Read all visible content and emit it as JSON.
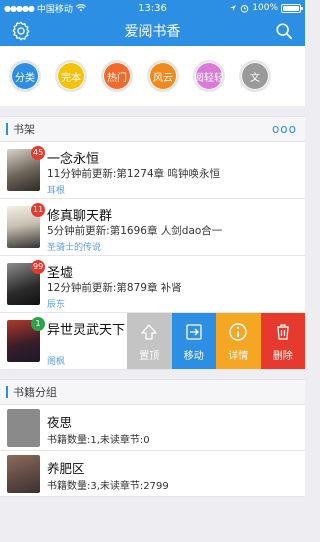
{
  "status_bar": {
    "carrier": "中国移动",
    "time": "13:36",
    "battery": "100%",
    "battery_level": 1.0
  },
  "nav": {
    "title": "爱阅书香",
    "settings_icon": "gear-icon",
    "search_icon": "search-icon"
  },
  "categories": [
    {
      "label": "分类",
      "color": "#2d8fe3"
    },
    {
      "label": "完本",
      "color": "#f4c20d"
    },
    {
      "label": "热门",
      "color": "#f26a2b"
    },
    {
      "label": "风云",
      "color": "#f08a1c"
    },
    {
      "label": "阅轻轻",
      "color": "#d97ad8"
    },
    {
      "label": "文",
      "color": "#9a9a9a"
    }
  ],
  "shelf": {
    "title": "书架",
    "more": "ooo",
    "books": [
      {
        "title": "一念永恒",
        "update": "11分钟前更新:第1274章 鸣钟唤永恒",
        "author": "耳根",
        "badge": "45"
      },
      {
        "title": "修真聊天群",
        "update": "5分钟前更新:第1696章 人剑dao合一",
        "author": "圣骑士的传说",
        "badge": "11"
      },
      {
        "title": "圣墟",
        "update": "12分钟前更新:第879章 补肾",
        "author": "辰东",
        "badge": "99"
      },
      {
        "title": "异世灵武天下",
        "update": "",
        "author": "阁枫",
        "badge": "1"
      }
    ],
    "actions": [
      {
        "label": "置顶",
        "icon": "pin-top-icon",
        "color": "#c4c4c4"
      },
      {
        "label": "移动",
        "icon": "move-icon",
        "color": "#2d8fe3"
      },
      {
        "label": "详情",
        "icon": "info-icon",
        "color": "#f5a623"
      },
      {
        "label": "删除",
        "icon": "trash-icon",
        "color": "#e53a2d"
      }
    ]
  },
  "groups": {
    "title": "书籍分组",
    "items": [
      {
        "name": "夜思",
        "info": "书籍数量:1,未读章节:0"
      },
      {
        "name": "养肥区",
        "info": "书籍数量:3,未读章节:2799"
      }
    ]
  }
}
